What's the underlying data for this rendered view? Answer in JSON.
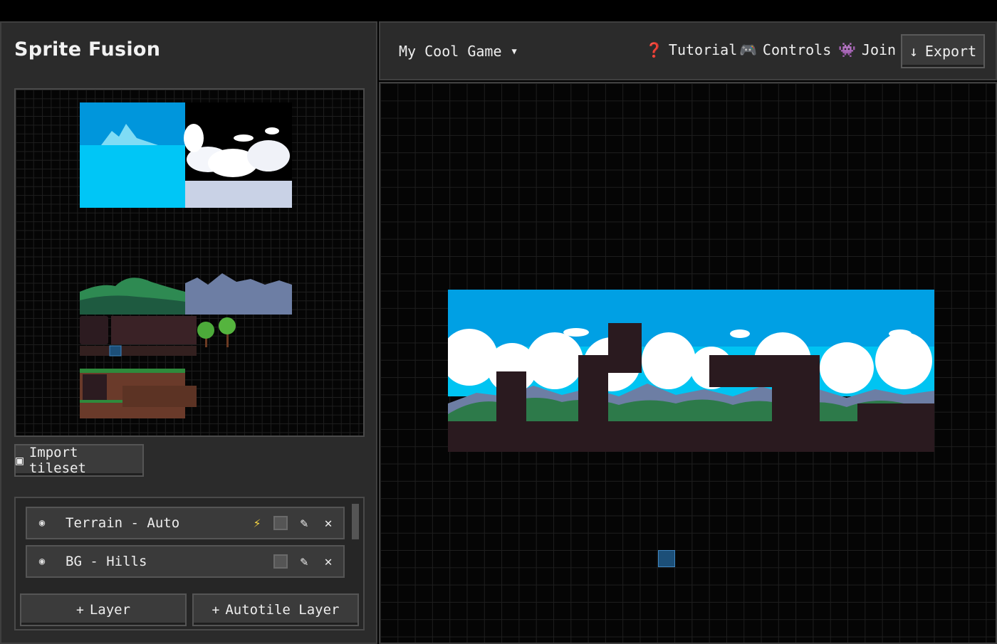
{
  "app": {
    "title": "Sprite Fusion"
  },
  "tileset": {
    "import_label": "Import tileset",
    "import_icon": "image-icon"
  },
  "layers": [
    {
      "name": "Terrain - Auto",
      "autotile": true
    },
    {
      "name": "BG - Hills",
      "autotile": false
    }
  ],
  "layer_actions": {
    "add_layer": "Layer",
    "add_autotile_layer": "Autotile Layer"
  },
  "header": {
    "project_name": "My Cool Game",
    "nav": {
      "tutorial": "Tutorial",
      "controls": "Controls",
      "join": "Join"
    },
    "export": "Export"
  },
  "colors": {
    "sky": "#00a0e4",
    "sky_light": "#00c8f8",
    "dirt": "#2a1a1f",
    "hill_green": "#2d7a4a",
    "mountain": "#6d7ea4",
    "panel": "#2b2b2b"
  }
}
